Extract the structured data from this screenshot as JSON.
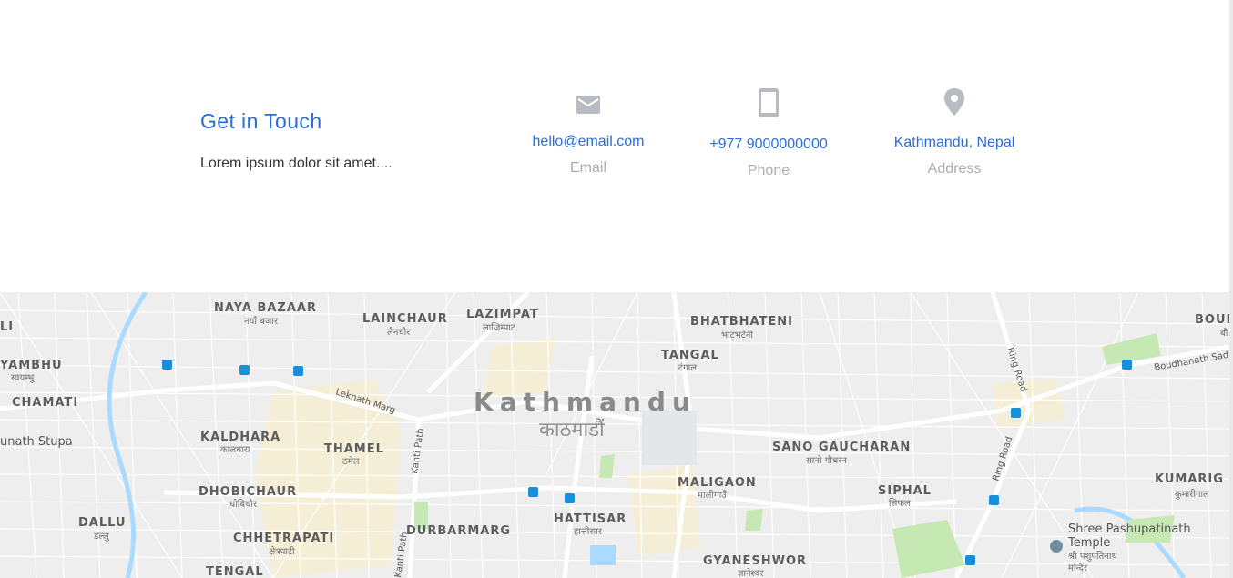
{
  "contact": {
    "title": "Get in Touch",
    "description": "Lorem ipsum dolor sit amet....",
    "items": [
      {
        "icon": "envelope-icon",
        "value": "hello@email.com",
        "label": "Email"
      },
      {
        "icon": "mobile-phone-icon",
        "value": "+977 9000000000",
        "label": "Phone"
      },
      {
        "icon": "map-pin-icon",
        "value": "Kathmandu, Nepal",
        "label": "Address"
      }
    ]
  },
  "map": {
    "city": "Kathmandu",
    "city_local": "काठमाडौं",
    "areas": [
      {
        "name": "NAYA BAZAAR",
        "local": "नयाँ बजार"
      },
      {
        "name": "LAINCHAUR",
        "local": "लैनचौर"
      },
      {
        "name": "LAZIMPAT",
        "local": "लाजिम्पाट"
      },
      {
        "name": "BHATBHATENI",
        "local": "भाटभटेनी"
      },
      {
        "name": "TANGAL",
        "local": "टंगाल"
      },
      {
        "name": "BOUD",
        "local": "बौ"
      },
      {
        "name": "YAMBHU",
        "local": "स्वयम्भु"
      },
      {
        "name": "CHAMATI",
        "local": ""
      },
      {
        "name": "LI",
        "local": ""
      },
      {
        "name": "KALDHARA",
        "local": "कालधारा"
      },
      {
        "name": "THAMEL",
        "local": "ठमेल"
      },
      {
        "name": "SANO GAUCHARAN",
        "local": "सानो गौचरन"
      },
      {
        "name": "DHOBICHAUR",
        "local": "धोबिचौर"
      },
      {
        "name": "MALIGAON",
        "local": "मालीगाउँ"
      },
      {
        "name": "SIPHAL",
        "local": "सिफल"
      },
      {
        "name": "KUMARIG",
        "local": "कुमारीगाल"
      },
      {
        "name": "DALLU",
        "local": "डल्लु"
      },
      {
        "name": "DURBARMARG",
        "local": ""
      },
      {
        "name": "HATTISAR",
        "local": "हात्तीसार"
      },
      {
        "name": "CHHETRAPATI",
        "local": "क्षेत्रपाटी"
      },
      {
        "name": "GYANESHWOR",
        "local": "ज्ञानेश्वर"
      },
      {
        "name": "TENGAL",
        "local": ""
      }
    ],
    "roads": [
      "Leknath Marg",
      "Kanti Path",
      "Ring Road",
      "Boudhanath Sada"
    ],
    "places": [
      {
        "name": "unath Stupa"
      },
      {
        "name": "Shree Pashupatinath",
        "name2": "Temple",
        "local": "श्री पशुपतिनाथ",
        "local2": "मन्दिर"
      }
    ]
  }
}
